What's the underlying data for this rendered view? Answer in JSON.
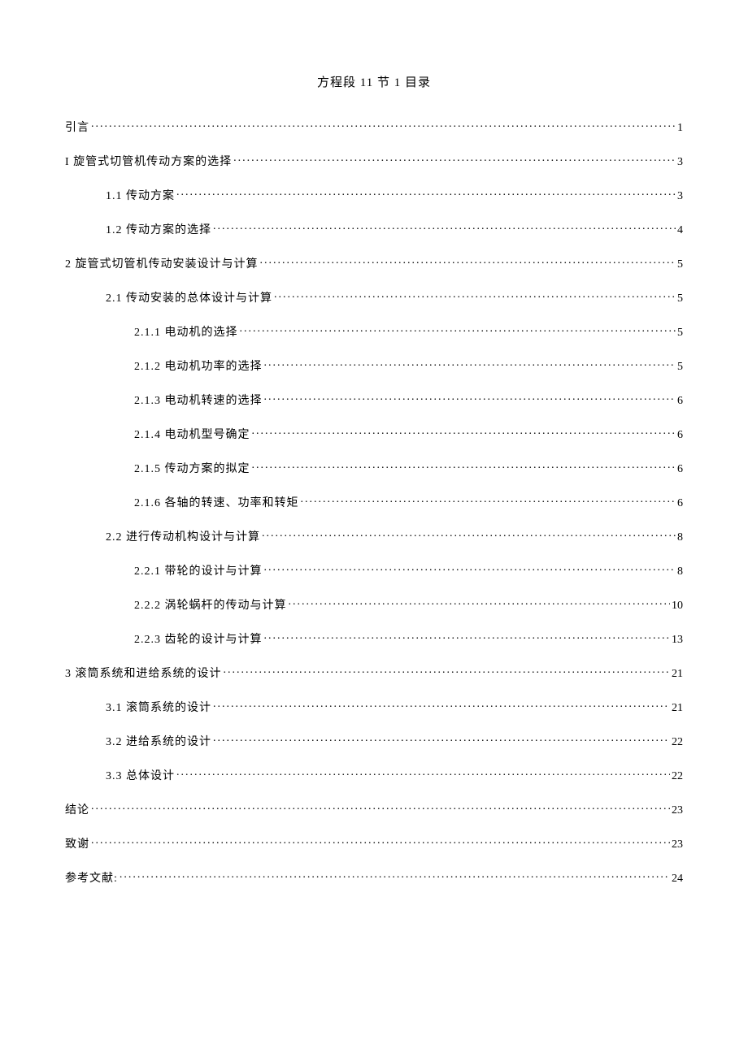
{
  "title": "方程段 11 节 1 目录",
  "entries": [
    {
      "label": "引言",
      "page": "1",
      "indent": 0
    },
    {
      "label": "I 旋管式切管机传动方案的选择",
      "page": "3",
      "indent": 0
    },
    {
      "label": "1.1 传动方案",
      "page": "3",
      "indent": 1
    },
    {
      "label": "1.2 传动方案的选择",
      "page": "4",
      "indent": 1
    },
    {
      "label": "2 旋管式切管机传动安装设计与计算",
      "page": "5",
      "indent": 0
    },
    {
      "label": "2.1 传动安装的总体设计与计算",
      "page": "5",
      "indent": 1
    },
    {
      "label": "2.1.1 电动机的选择",
      "page": "5",
      "indent": 2
    },
    {
      "label": "2.1.2 电动机功率的选择",
      "page": "5",
      "indent": 2
    },
    {
      "label": "2.1.3 电动机转速的选择",
      "page": "6",
      "indent": 2
    },
    {
      "label": "2.1.4 电动机型号确定",
      "page": "6",
      "indent": 2
    },
    {
      "label": "2.1.5 传动方案的拟定",
      "page": "6",
      "indent": 2
    },
    {
      "label": "2.1.6 各轴的转速、功率和转矩",
      "page": "6",
      "indent": 2
    },
    {
      "label": "2.2 进行传动机构设计与计算",
      "page": "8",
      "indent": 1
    },
    {
      "label": "2.2.1 带轮的设计与计算",
      "page": "8",
      "indent": 2
    },
    {
      "label": "2.2.2 涡轮蜗杆的传动与计算",
      "page": "10",
      "indent": 2
    },
    {
      "label": "2.2.3 齿轮的设计与计算",
      "page": "13",
      "indent": 2
    },
    {
      "label": "3 滚筒系统和进给系统的设计",
      "page": "21",
      "indent": 0
    },
    {
      "label": "3.1 滚筒系统的设计",
      "page": "21",
      "indent": 1
    },
    {
      "label": "3.2 进给系统的设计",
      "page": "22",
      "indent": 1
    },
    {
      "label": "3.3 总体设计",
      "page": "22",
      "indent": 1
    },
    {
      "label": "结论",
      "page": "23",
      "indent": 0
    },
    {
      "label": "致谢",
      "page": "23",
      "indent": 0
    },
    {
      "label": "参考文献:",
      "page": "24",
      "indent": 0
    }
  ]
}
